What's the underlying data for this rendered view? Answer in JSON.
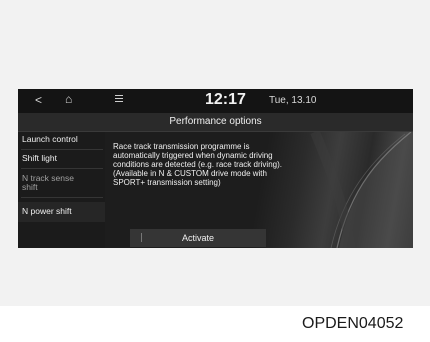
{
  "statusbar": {
    "back_glyph": "<",
    "home_glyph": "⌂",
    "time": "12:17",
    "date": "Tue, 13.10"
  },
  "title": "Performance options",
  "sidebar": {
    "items": [
      {
        "label": "Launch control",
        "state": "normal"
      },
      {
        "label": "Shift light",
        "state": "normal"
      },
      {
        "label": "N track sense shift",
        "state": "disabled"
      },
      {
        "label": "N power shift",
        "state": "selected"
      }
    ]
  },
  "content": {
    "description": "Race track transmission programme is automatically triggered when dynamic driving conditions are detected (e.g. race track driving). (Available in N & CUSTOM drive mode with SPORT+ transmission setting)",
    "activate_label": "Activate"
  },
  "figure_code": "OPDEN04052",
  "icons": [
    "back-arrow-icon",
    "home-icon",
    "menu-icon"
  ],
  "colors": {
    "screen_bg": "#101010",
    "sidebar_bg": "#1b1b1b",
    "button_bg": "#353535"
  }
}
